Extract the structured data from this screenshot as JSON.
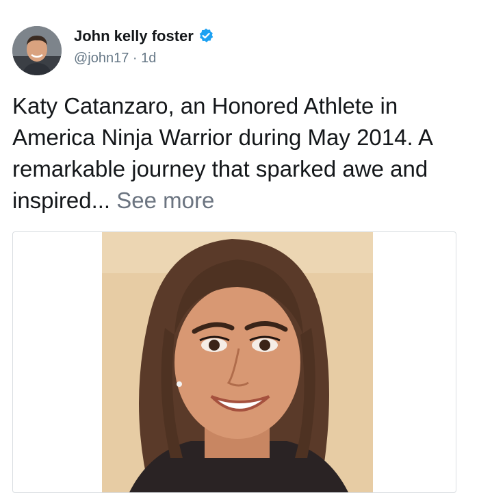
{
  "author": {
    "name": "John kelly foster",
    "handle": "@john17",
    "separator": " · ",
    "time": "1d",
    "verified": true,
    "avatar_icon": "person-avatar"
  },
  "tweet": {
    "text": "Katy Catanzaro, an Honored Athlete in America Ninja Warrior during May 2014. A remarkable journey that sparked awe and inspired...",
    "see_more": "See more"
  },
  "media": {
    "type": "photo",
    "subject": "woman-selfie-photo"
  },
  "colors": {
    "text": "#14171a",
    "secondary": "#657786",
    "verified": "#1da1f2",
    "see_more": "#6b7480",
    "border": "#d9dde1"
  }
}
